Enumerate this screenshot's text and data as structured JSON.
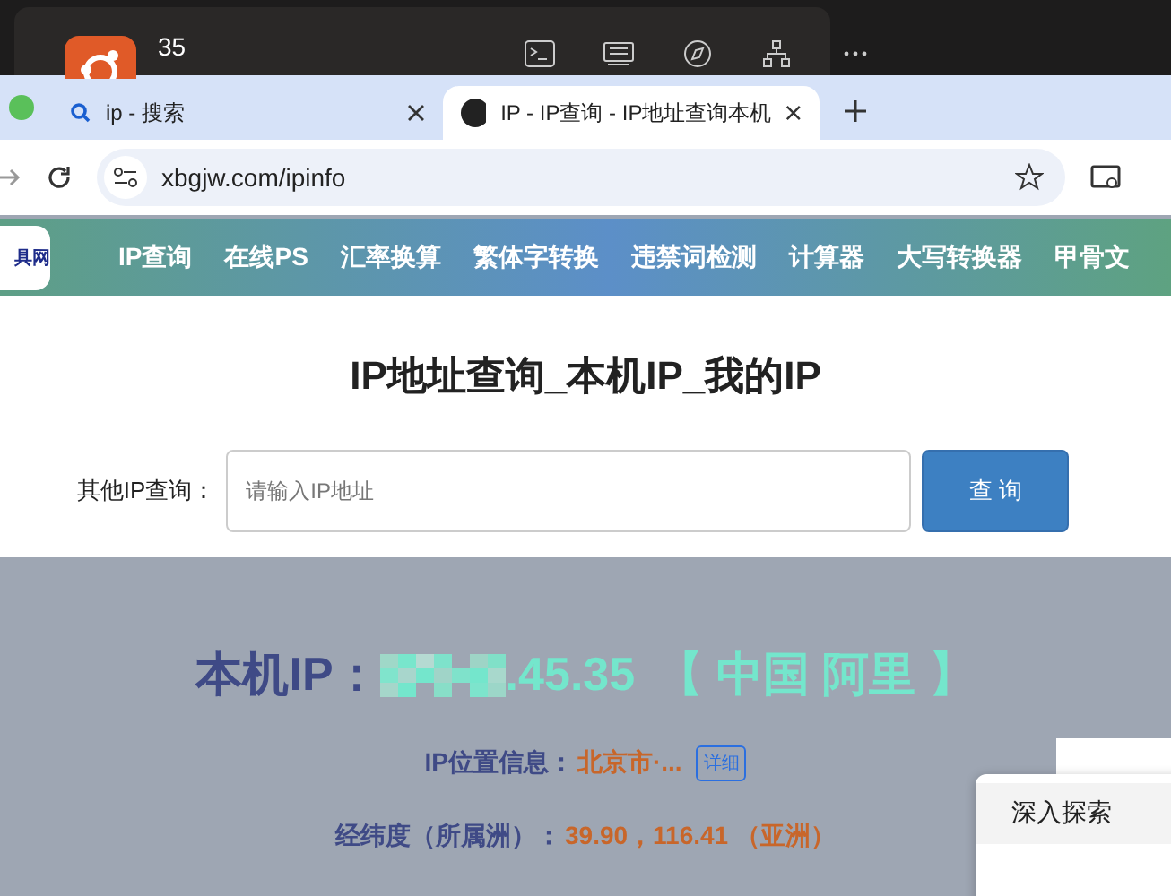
{
  "dock": {
    "badge": "35"
  },
  "tabs": [
    {
      "title": "ip - 搜索",
      "selected": false
    },
    {
      "title": "IP - IP查询 - IP地址查询本机",
      "selected": true
    }
  ],
  "address_bar": {
    "url": "xbgjw.com/ipinfo"
  },
  "site": {
    "logo_text": "具网",
    "nav": [
      "IP查询",
      "在线PS",
      "汇率换算",
      "繁体字转换",
      "违禁词检测",
      "计算器",
      "大写转换器",
      "甲骨文"
    ],
    "title": "IP地址查询_本机IP_我的IP",
    "search": {
      "label": "其他IP查询：",
      "placeholder": "请输入IP地址",
      "button": "查 询"
    },
    "result": {
      "label": "本机IP：",
      "ip_visible": ".45.35",
      "region": "【 中国 阿里 】",
      "rows": [
        {
          "label": "IP位置信息：",
          "value": "北京市·...",
          "link": "详细"
        },
        {
          "label": "经纬度（所属洲）：",
          "value": "39.90，116.41 （亚洲）"
        }
      ]
    }
  },
  "popup": {
    "items": [
      "深入探索"
    ]
  }
}
